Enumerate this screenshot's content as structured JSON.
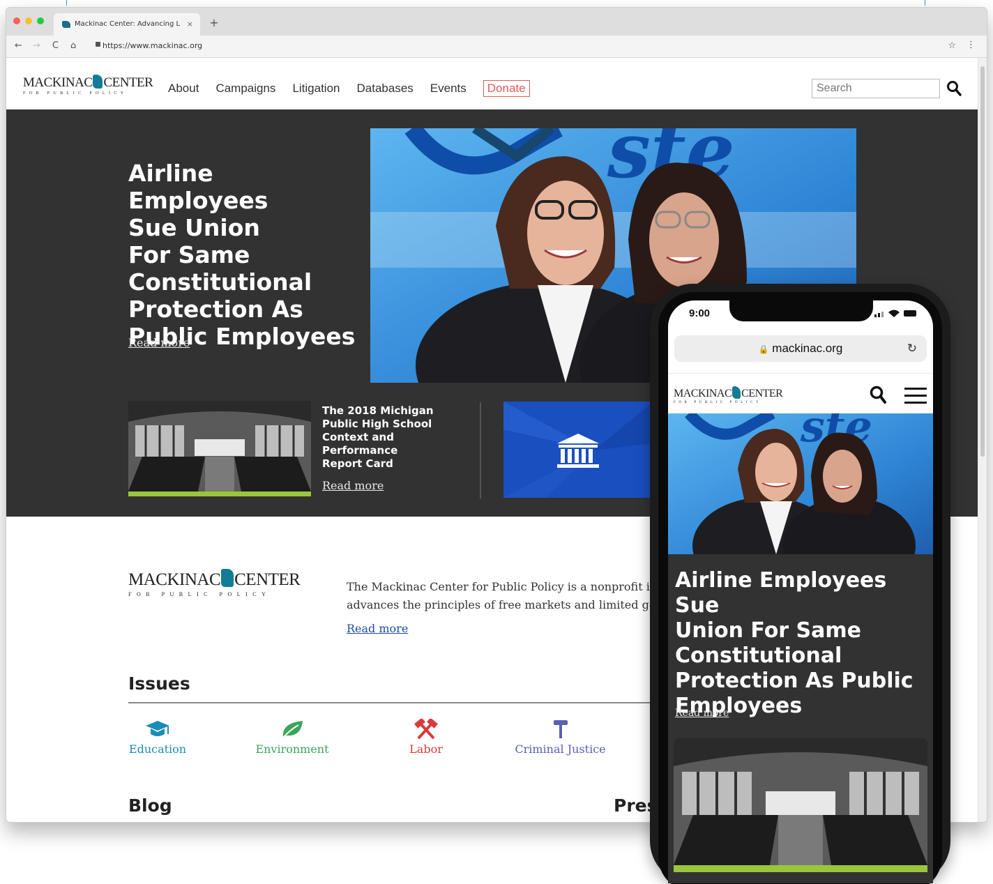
{
  "browser": {
    "tab_title": "Mackinac Center: Advancing L",
    "tab_close": "×",
    "new_tab": "+",
    "url": "https://www.mackinac.org",
    "back": "←",
    "forward": "→",
    "reload": "C",
    "home": "⌂",
    "bookmark": "☆",
    "menu": "⋮"
  },
  "site": {
    "logo_main_left": "MACKINAC",
    "logo_main_right": "CENTER",
    "logo_sub": "FOR PUBLIC POLICY",
    "nav": [
      "About",
      "Campaigns",
      "Litigation",
      "Databases",
      "Events",
      "Donate"
    ],
    "search_placeholder": "Search",
    "accent": "#127d95",
    "donate_color": "#e05a5a"
  },
  "hero": {
    "title_lines": [
      "Airline Employees",
      "Sue Union",
      "For Same",
      "Constitutional",
      "Protection As",
      "Public Employees"
    ],
    "read_more": "Read more",
    "sub_title_lines": [
      "The 2018 Michigan",
      "Public High School",
      "Context and",
      "Performance",
      "Report Card"
    ],
    "sub_read_more": "Read more",
    "photo_sign_text": "ste"
  },
  "about": {
    "text_line1": "The Mackinac Center for Public Policy is a nonprofit i",
    "text_line2": "advances the principles of free markets and limited go",
    "read_more": "Read more"
  },
  "issues": {
    "heading": "Issues",
    "items": [
      {
        "label": "Education",
        "icon": "graduation-cap-icon",
        "color": "#1b8cb5"
      },
      {
        "label": "Environment",
        "icon": "leaf-icon",
        "color": "#3aa65a"
      },
      {
        "label": "Labor",
        "icon": "crossed-hammers-icon",
        "color": "#d93b3b"
      },
      {
        "label": "Criminal Justice",
        "icon": "gavel-icon",
        "color": "#5a5fb5"
      }
    ]
  },
  "sections": {
    "blog": "Blog",
    "press": "Pres"
  },
  "phone": {
    "time": "9:00",
    "url": "mackinac.org",
    "reload": "↻",
    "title_lines": [
      "Airline Employees Sue",
      "Union For Same",
      "Constitutional",
      "Protection As Public",
      "Employees"
    ],
    "read_more": "Read more"
  }
}
